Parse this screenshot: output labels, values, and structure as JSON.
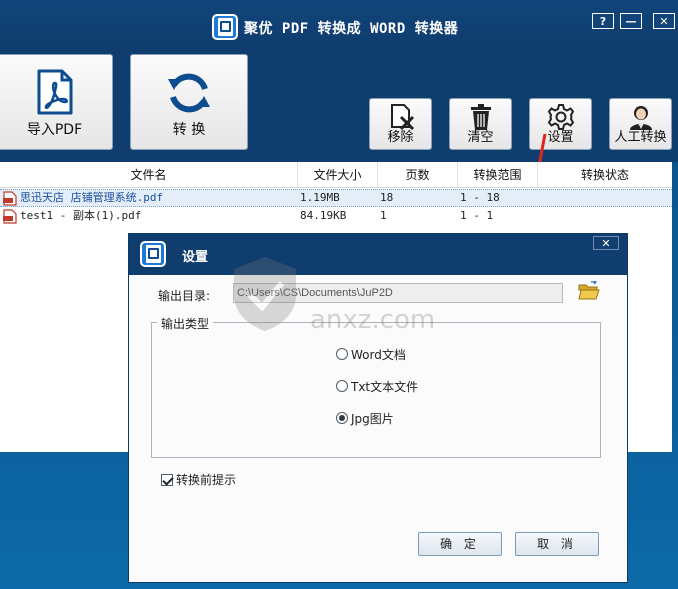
{
  "window": {
    "title": "聚优 PDF 转换成 WORD 转换器",
    "help_label": "?",
    "minimize_label": "—",
    "close_label": "✕"
  },
  "toolbar": {
    "import_label": "导入PDF",
    "convert_label": "转 换",
    "remove_label": "移除",
    "clear_label": "清空",
    "settings_label": "设置",
    "manual_label": "人工转换"
  },
  "table": {
    "headers": [
      "文件名",
      "文件大小",
      "页数",
      "转换范围",
      "转换状态"
    ],
    "rows": [
      {
        "name": "思迅天店 店铺管理系统.pdf",
        "size": "1.19MB",
        "pages": "18",
        "range": "1 - 18",
        "status": ""
      },
      {
        "name": "test1 - 副本(1).pdf",
        "size": "84.19KB",
        "pages": "1",
        "range": "1 - 1",
        "status": ""
      }
    ]
  },
  "dialog": {
    "title": "设置",
    "close_label": "✕",
    "output_dir_label": "输出目录:",
    "output_path": "C:\\Users\\CS\\Documents\\JuP2D",
    "output_type_label": "输出类型",
    "options": [
      {
        "label": "Word文档",
        "checked": false
      },
      {
        "label": "Txt文本文件",
        "checked": false
      },
      {
        "label": "Jpg图片",
        "checked": true
      }
    ],
    "prompt_label": "转换前提示",
    "prompt_checked": true,
    "ok_label": "确 定",
    "cancel_label": "取 消"
  },
  "watermark": {
    "text": "anxz.com"
  },
  "colors": {
    "title_bar": "#0f3d6e",
    "annotation_arrow": "#e0241c",
    "selected_row": "#e4eef9"
  }
}
